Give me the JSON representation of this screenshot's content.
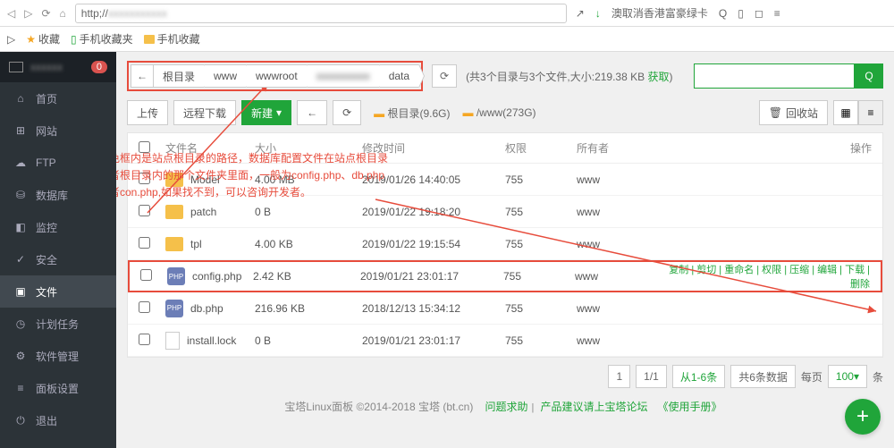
{
  "browser": {
    "url_prefix": "http;//",
    "url_blur": "xxxxxxxxxxx",
    "search_hint": "澳取消香港富豪绿卡"
  },
  "bookmarks": {
    "fav": "收藏",
    "mobile_folder": "手机收藏夹",
    "mobile": "手机收藏"
  },
  "sidebar": {
    "badge": "0",
    "items": [
      {
        "icon": "⌂",
        "label": "首页"
      },
      {
        "icon": "⊞",
        "label": "网站"
      },
      {
        "icon": "☁",
        "label": "FTP"
      },
      {
        "icon": "⛁",
        "label": "数据库"
      },
      {
        "icon": "◧",
        "label": "监控"
      },
      {
        "icon": "✓",
        "label": "安全"
      },
      {
        "icon": "▣",
        "label": "文件"
      },
      {
        "icon": "◷",
        "label": "计划任务"
      },
      {
        "icon": "⚙",
        "label": "软件管理"
      },
      {
        "icon": "≡",
        "label": "面板设置"
      },
      {
        "icon": "⏻",
        "label": "退出"
      }
    ]
  },
  "breadcrumb": {
    "back": "←",
    "segs": [
      "根目录",
      "www",
      "wwwroot",
      "xxxxxxxxxx",
      "data"
    ]
  },
  "stats": {
    "text": "(共3个目录与3个文件,大小:219.38 KB",
    "link": "获取",
    "close": ")"
  },
  "toolbar": {
    "upload": "上传",
    "remote": "远程下载",
    "new": "新建",
    "rootdir": "根目录(9.6G)",
    "www": "/www(273G)",
    "trash": "回收站"
  },
  "columns": {
    "name": "文件名",
    "size": "大小",
    "mtime": "修改时间",
    "perm": "权限",
    "owner": "所有者",
    "ops": "操作"
  },
  "rows": [
    {
      "type": "folder",
      "name": "Model",
      "size": "4.00 MB",
      "time": "2019/01/26 14:40:05",
      "perm": "755",
      "owner": "www"
    },
    {
      "type": "folder",
      "name": "patch",
      "size": "0 B",
      "time": "2019/01/22 19:18:20",
      "perm": "755",
      "owner": "www"
    },
    {
      "type": "folder",
      "name": "tpl",
      "size": "4.00 KB",
      "time": "2019/01/22 19:15:54",
      "perm": "755",
      "owner": "www"
    },
    {
      "type": "php",
      "name": "config.php",
      "size": "2.42 KB",
      "time": "2019/01/21 23:01:17",
      "perm": "755",
      "owner": "www",
      "ops": "复制 | 剪切 | 重命名 | 权限 | 压缩 | 编辑 | 下载 | 删除"
    },
    {
      "type": "php",
      "name": "db.php",
      "size": "216.96 KB",
      "time": "2018/12/13 15:34:12",
      "perm": "755",
      "owner": "www"
    },
    {
      "type": "file",
      "name": "install.lock",
      "size": "0 B",
      "time": "2019/01/21 23:01:17",
      "perm": "755",
      "owner": "www"
    }
  ],
  "annotation": {
    "l1": "红色框内是站点根目录的路径，数据库配置文件在站点根目录",
    "l2": "或者根目录内的那个文件夹里面，一般为config.php、db.php",
    "l3": "或者con.php,如果找不到，可以咨询开发者。"
  },
  "pagination": {
    "page": "1",
    "total": "1/1",
    "range": "从1-6条",
    "count": "共6条数据",
    "per": "每页",
    "num": "100",
    "unit": "条"
  },
  "footer": {
    "copyright": "宝塔Linux面板 ©2014-2018 宝塔 (bt.cn)",
    "help": "问题求助",
    "suggest": "产品建议请上宝塔论坛",
    "manual": "《使用手册》"
  }
}
